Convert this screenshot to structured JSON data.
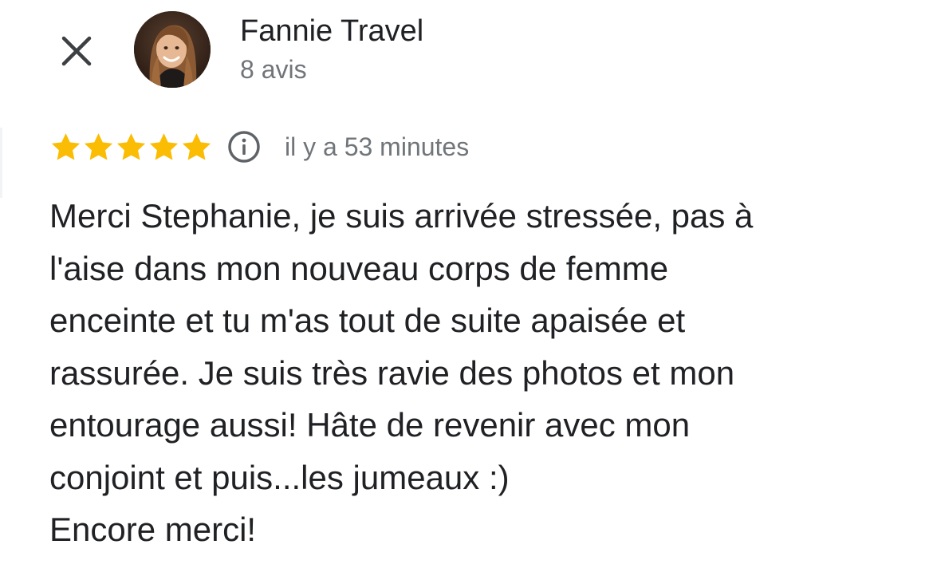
{
  "header": {
    "author_name": "Fannie Travel",
    "review_count": "8 avis"
  },
  "icons": {
    "close": "close-icon",
    "avatar": "avatar",
    "star": "star-icon",
    "info": "info-icon"
  },
  "rating": {
    "stars": 5,
    "max": 5,
    "time_ago": "il y a 53 minutes"
  },
  "review": {
    "lines": [
      "Merci Stephanie, je suis arrivée stressée, pas à",
      "l'aise dans mon nouveau corps de femme",
      "enceinte et tu m'as tout de suite apaisée et",
      "rassurée. Je suis très ravie des photos et mon",
      "entourage aussi! Hâte de revenir avec mon",
      "conjoint et puis...les jumeaux :)",
      "Encore merci!"
    ]
  },
  "colors": {
    "star": "#fbbc04",
    "text_primary": "#202124",
    "text_secondary": "#70757a",
    "icon": "#5f6368"
  }
}
